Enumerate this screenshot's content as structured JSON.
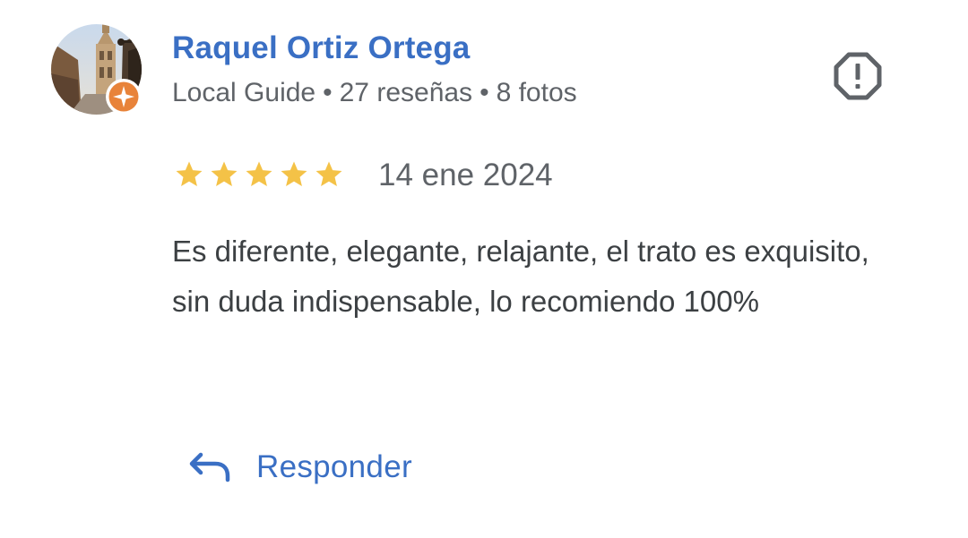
{
  "reviewer": {
    "name": "Raquel Ortiz Ortega",
    "level": "Local Guide",
    "separator": "•",
    "reviews": "27 reseñas",
    "photos": "8 fotos"
  },
  "review": {
    "rating": 5,
    "max_rating": 5,
    "date": "14 ene 2024",
    "text": "Es diferente, elegante, relajante, el trato es exquisito, sin duda indispensable, lo recomiendo 100%"
  },
  "actions": {
    "reply_label": "Responder",
    "report_icon": "report-flag-icon",
    "reply_icon": "reply-arrow-icon"
  },
  "colors": {
    "link_blue": "#3a6fc4",
    "star_gold": "#f4c247",
    "meta_gray": "#5f6368",
    "badge_orange": "#e8833a"
  }
}
